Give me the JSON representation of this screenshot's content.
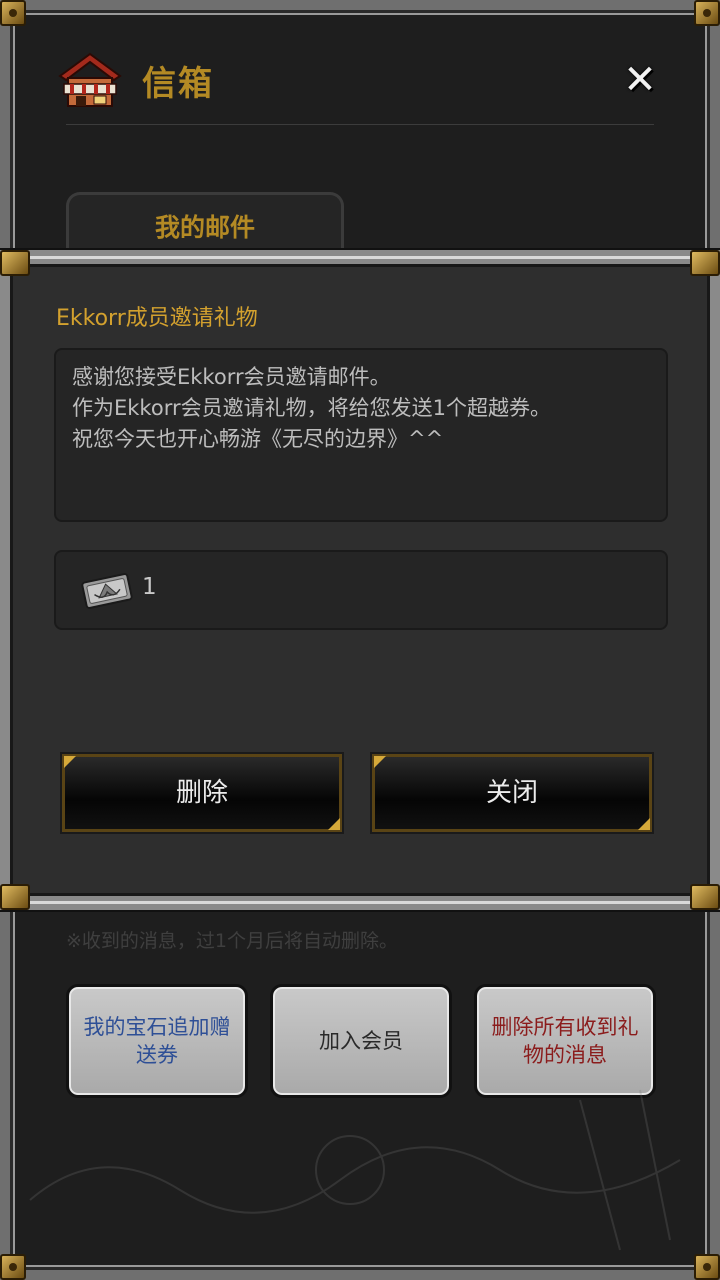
{
  "header": {
    "title": "信箱"
  },
  "tabs": {
    "my_mail": "我的邮件"
  },
  "notice": "※收到的消息，过1个月后将自动删除。",
  "bottom_buttons": {
    "gem_coupon": "我的宝石追加赠送券",
    "join_member": "加入会员",
    "delete_all": "删除所有收到礼物的消息"
  },
  "dialog": {
    "subject": "Ekkorr成员邀请礼物",
    "body_lines": [
      "感谢您接受Ekkorr会员邀请邮件。",
      "作为Ekkorr会员邀请礼物，将给您发送1个超越券。",
      "祝您今天也开心畅游《无尽的边界》^^"
    ],
    "attachment": {
      "icon": "transcend-ticket-icon",
      "count": "1"
    },
    "delete_label": "删除",
    "close_label": "关闭"
  },
  "colors": {
    "accent_gold": "#b48a24",
    "subject_gold": "#d3a12e",
    "gem_blue": "#2e4f96",
    "delete_red": "#8b1c1c"
  }
}
